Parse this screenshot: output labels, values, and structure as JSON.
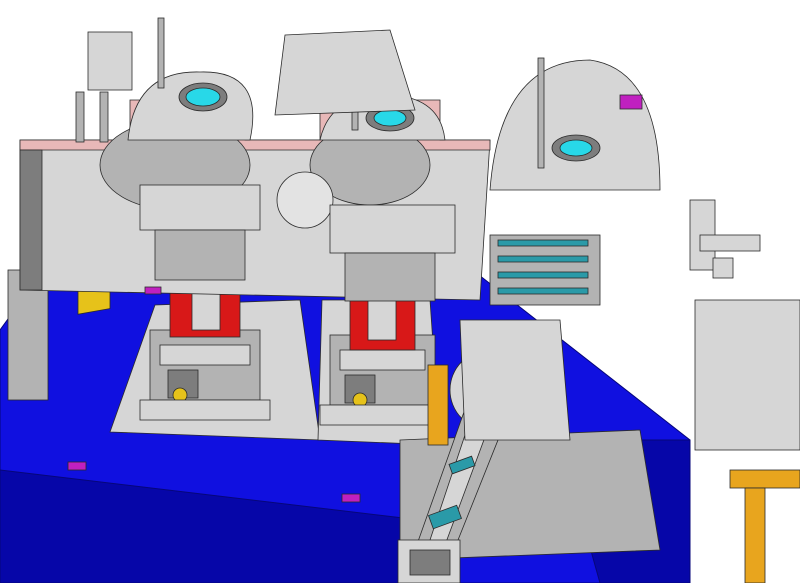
{
  "scene": {
    "kind": "cad-render",
    "subject": "vacuum-chamber-assembly",
    "colors": {
      "background": "#ffffff",
      "steel_light": "#d6d6d6",
      "steel_mid": "#b3b3b3",
      "steel_dark": "#7d7d7d",
      "edge": "#2b2b2b",
      "section_cut": "#e8b8b8",
      "base_blue": "#1010e0",
      "base_blue_dark": "#0606a8",
      "mount_red": "#d81818",
      "viewport_cyan": "#28d8e8",
      "support_yellow": "#e6c21a",
      "support_orange": "#e8a51e",
      "accent_magenta": "#c020c0",
      "accent_teal": "#2a9aa8"
    },
    "icons": [
      "section-view-chamber",
      "viewport-window",
      "manipulator-bellows",
      "stepper-motor",
      "lifting-stage"
    ]
  }
}
